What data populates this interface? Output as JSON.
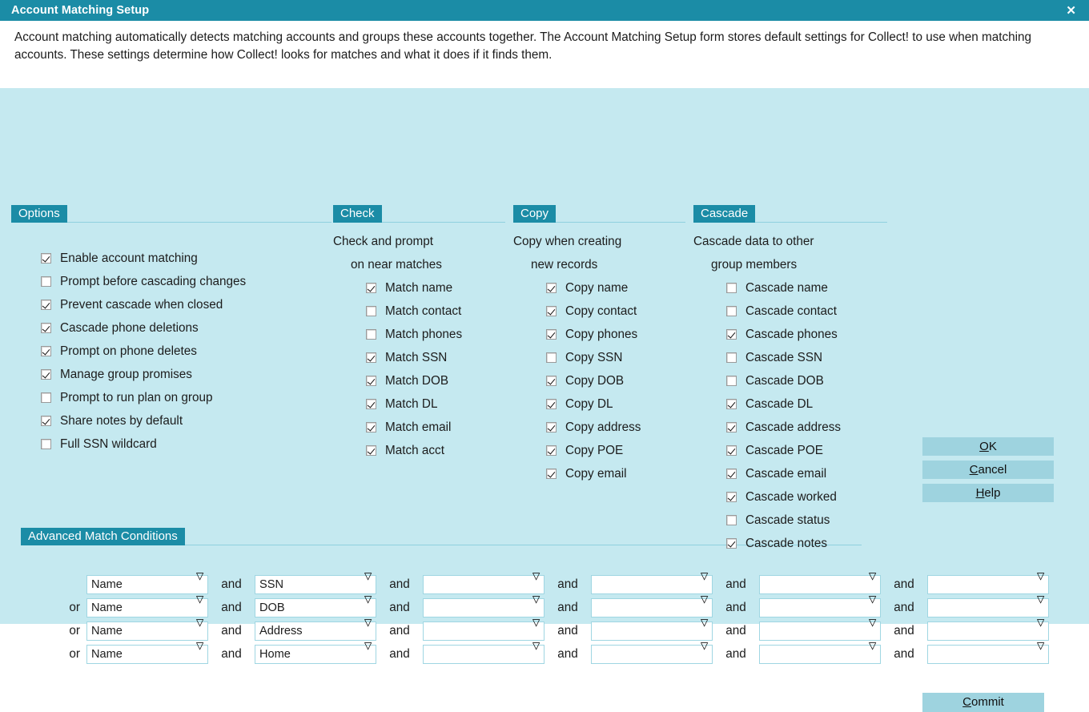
{
  "window": {
    "title": "Account Matching Setup",
    "close_icon": "close-icon",
    "close_glyph": "✕"
  },
  "description": "Account matching automatically detects matching accounts and groups these accounts together. The Account Matching Setup form stores default settings for Collect! to use when matching accounts. These settings determine how Collect! looks for matches and what it does if it finds them.",
  "colors": {
    "titlebar": "#1b8ca6",
    "tab": "#1b8ca6",
    "body": "#c5e9f0",
    "button": "#9ed3df",
    "rule": "#8fd0de",
    "field_border": "#9fd6e2"
  },
  "sections": {
    "options": {
      "tab_label": "Options",
      "items": [
        {
          "label": "Enable account matching",
          "checked": true
        },
        {
          "label": "Prompt before cascading changes",
          "checked": false
        },
        {
          "label": "Prevent cascade when closed",
          "checked": true
        },
        {
          "label": "Cascade phone deletions",
          "checked": true
        },
        {
          "label": "Prompt on phone deletes",
          "checked": true
        },
        {
          "label": "Manage group promises",
          "checked": true
        },
        {
          "label": "Prompt to run plan on group",
          "checked": false
        },
        {
          "label": "Share notes by default",
          "checked": true
        },
        {
          "label": "Full SSN wildcard",
          "checked": false
        }
      ]
    },
    "check": {
      "tab_label": "Check",
      "caption_line1": "Check and prompt",
      "caption_line2": "on near matches",
      "items": [
        {
          "label": "Match name",
          "checked": true
        },
        {
          "label": "Match contact",
          "checked": false
        },
        {
          "label": "Match phones",
          "checked": false
        },
        {
          "label": "Match SSN",
          "checked": true
        },
        {
          "label": "Match DOB",
          "checked": true
        },
        {
          "label": "Match DL",
          "checked": true
        },
        {
          "label": "Match email",
          "checked": true
        },
        {
          "label": "Match acct",
          "checked": true
        }
      ]
    },
    "copy": {
      "tab_label": "Copy",
      "caption_line1": "Copy when creating",
      "caption_line2": "new records",
      "items": [
        {
          "label": "Copy name",
          "checked": true
        },
        {
          "label": "Copy contact",
          "checked": true
        },
        {
          "label": "Copy phones",
          "checked": true
        },
        {
          "label": "Copy SSN",
          "checked": false
        },
        {
          "label": "Copy DOB",
          "checked": true
        },
        {
          "label": "Copy DL",
          "checked": true
        },
        {
          "label": "Copy address",
          "checked": true
        },
        {
          "label": "Copy POE",
          "checked": true
        },
        {
          "label": "Copy email",
          "checked": true
        }
      ]
    },
    "cascade": {
      "tab_label": "Cascade",
      "caption_line1": "Cascade data to other",
      "caption_line2": "group members",
      "items": [
        {
          "label": "Cascade name",
          "checked": false
        },
        {
          "label": "Cascade contact",
          "checked": false
        },
        {
          "label": "Cascade phones",
          "checked": true
        },
        {
          "label": "Cascade SSN",
          "checked": false
        },
        {
          "label": "Cascade DOB",
          "checked": false
        },
        {
          "label": "Cascade DL",
          "checked": true
        },
        {
          "label": "Cascade address",
          "checked": true
        },
        {
          "label": "Cascade POE",
          "checked": true
        },
        {
          "label": "Cascade email",
          "checked": true
        },
        {
          "label": "Cascade worked",
          "checked": true
        },
        {
          "label": "Cascade status",
          "checked": false
        },
        {
          "label": "Cascade notes",
          "checked": true
        }
      ]
    },
    "advanced": {
      "tab_label": "Advanced Match Conditions",
      "conjunction_or": "or",
      "conjunction_and": "and",
      "rows": [
        {
          "leading": "",
          "fields": [
            "Name",
            "SSN",
            "",
            "",
            "",
            ""
          ]
        },
        {
          "leading": "or",
          "fields": [
            "Name",
            "DOB",
            "",
            "",
            "",
            ""
          ]
        },
        {
          "leading": "or",
          "fields": [
            "Name",
            "Address",
            "",
            "",
            "",
            ""
          ]
        },
        {
          "leading": "or",
          "fields": [
            "Name",
            "Home",
            "",
            "",
            "",
            ""
          ]
        }
      ]
    }
  },
  "buttons": {
    "ok": {
      "label": "OK",
      "accel": "O"
    },
    "cancel": {
      "label": "Cancel",
      "accel": "C"
    },
    "help": {
      "label": "Help",
      "accel": "H"
    },
    "commit": {
      "label": "Commit",
      "accel": "C"
    }
  }
}
